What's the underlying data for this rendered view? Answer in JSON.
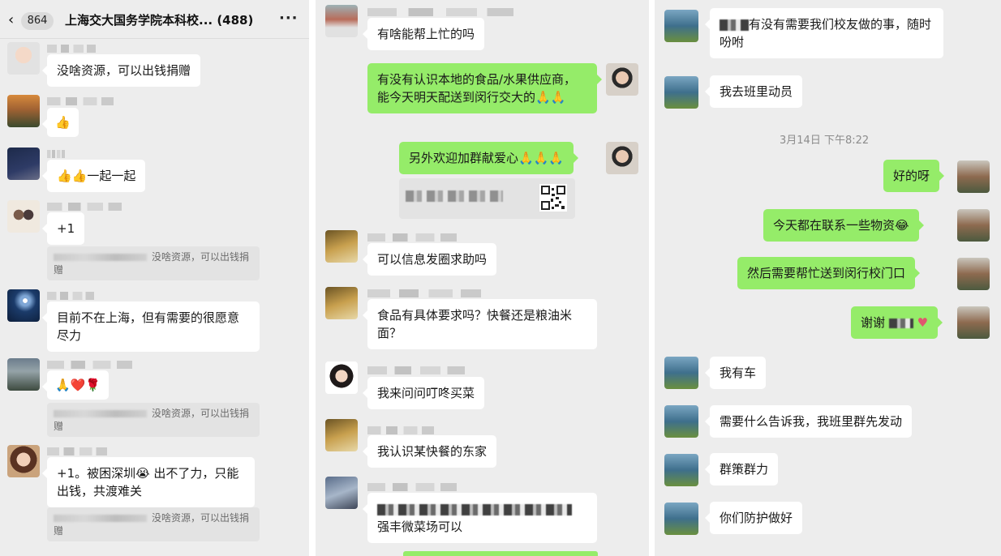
{
  "panel1": {
    "header": {
      "back_glyph": "‹",
      "unread_count": "864",
      "title": "上海交大国务学院本科校... (488)",
      "more_glyph": "···"
    },
    "messages": [
      {
        "text": "没啥资源，可以出钱捐赠"
      },
      {
        "text": "👍"
      },
      {
        "text": "👍👍一起一起"
      },
      {
        "text": "+1",
        "quote": "没啥资源，可以出钱捐赠"
      },
      {
        "text": "目前不在上海，但有需要的很愿意尽力"
      },
      {
        "text": "🙏❤️🌹",
        "quote": "没啥资源，可以出钱捐赠"
      },
      {
        "text": "+1。被困深圳😭 出不了力，只能出钱，共渡难关",
        "quote": "没啥资源，可以出钱捐赠"
      }
    ]
  },
  "panel2": {
    "messages": [
      {
        "text": "有啥能帮上忙的吗"
      },
      {
        "text": "有没有认识本地的食品/水果供应商，能今天明天配送到闵行交大的🙏🙏"
      },
      {
        "text": "另外欢迎加群献爱心🙏🙏🙏"
      },
      {
        "text": "可以信息发圈求助吗"
      },
      {
        "text": "食品有具体要求吗？快餐还是粮油米面？"
      },
      {
        "text": "我来问问叮咚买菜"
      },
      {
        "text": "我认识某快餐的东家"
      },
      {
        "text": "强丰微菜场可以"
      }
    ]
  },
  "panel3": {
    "timestamp": "3月14日 下午8:22",
    "messages": [
      {
        "text": "有没有需要我们校友做的事，随时吩咐"
      },
      {
        "text": "我去班里动员"
      },
      {
        "text": "好的呀"
      },
      {
        "text": "今天都在联系一些物资😂"
      },
      {
        "text": "然后需要帮忙送到闵行校门口"
      },
      {
        "text": "谢谢"
      },
      {
        "text": "我有车"
      },
      {
        "text": "需要什么告诉我，我班里群先发动"
      },
      {
        "text": "群策群力"
      },
      {
        "text": "你们防护做好"
      }
    ]
  },
  "colors": {
    "chat_background": "#ededed",
    "incoming_bubble": "#ffffff",
    "outgoing_bubble": "#95ec69",
    "quote_background": "#e3e3e3",
    "timestamp_text": "#8c8c8c"
  }
}
